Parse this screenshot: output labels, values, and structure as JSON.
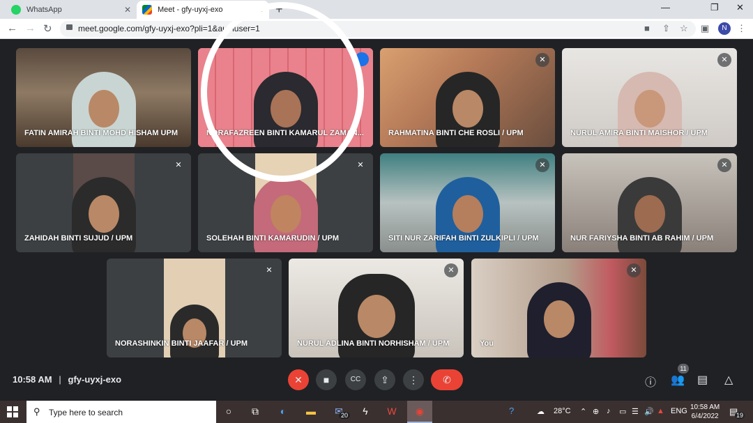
{
  "browser": {
    "tabs": [
      {
        "title": "WhatsApp",
        "close": "✕"
      },
      {
        "title": "Meet - gfy-uyxj-exo",
        "close": "✕"
      }
    ],
    "new_tab": "+",
    "url": "meet.google.com/gfy-uyxj-exo?pli=1&authuser=1",
    "profile_initial": "N",
    "window_controls": {
      "minimize": "—",
      "maximize": "❐",
      "close": "✕"
    }
  },
  "participants": [
    {
      "name": "FATIN AMIRAH BINTI MOHD HISHAM UPM",
      "muted": false
    },
    {
      "name": "NORAFAZREEN BINTI KAMARUL ZAMAN...",
      "muted": false,
      "speaking": true
    },
    {
      "name": "RAHMATINA BINTI CHE ROSLI / UPM",
      "muted": true
    },
    {
      "name": "NURUL AMIRA BINTI MAISHOR / UPM",
      "muted": true
    },
    {
      "name": "ZAHIDAH BINTI SUJUD / UPM",
      "muted": true
    },
    {
      "name": "SOLEHAH BINTI KAMARUDIN / UPM",
      "muted": true
    },
    {
      "name": "SITI NUR ZARIFAH BINTI ZULKIPLI / UPM",
      "muted": true
    },
    {
      "name": "NUR FARIYSHA BINTI AB RAHIM / UPM",
      "muted": true
    },
    {
      "name": "NORASHINKIN BINTI JAAFAR / UPM",
      "muted": true
    },
    {
      "name": "NURUL ADLINA BINTI NORHISHAM / UPM",
      "muted": true
    },
    {
      "name": "You",
      "muted": true
    }
  ],
  "meeting": {
    "time": "10:58 AM",
    "separator": "|",
    "code": "gfy-uyxj-exo",
    "participant_count": "11"
  },
  "taskbar": {
    "search_placeholder": "Type here to search",
    "mail_badge": "20",
    "temperature": "28°C",
    "language": "ENG",
    "time": "10:58 AM",
    "date": "6/4/2022",
    "notification_count": "19"
  },
  "colors": {
    "accent_red": "#ea4335",
    "active_outline": "#8ab4f8",
    "meet_bg": "#202124"
  }
}
